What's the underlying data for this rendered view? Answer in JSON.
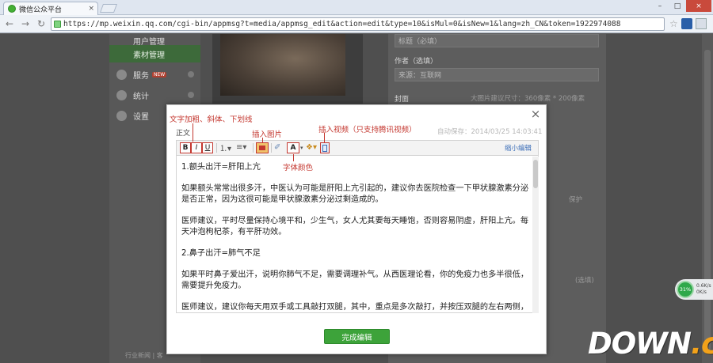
{
  "browser": {
    "tab_title": "微信公众平台",
    "tab_close": "×",
    "url": "https://mp.weixin.qq.com/cgi-bin/appmsg?t=media/appmsg_edit&action=edit&type=10&isMul=0&isNew=1&lang=zh_CN&token=1922974088",
    "window_buttons": [
      "–",
      "□",
      "×"
    ]
  },
  "sidebar": {
    "items": [
      {
        "label": "用户管理"
      },
      {
        "label": "素材管理"
      },
      {
        "label": "服务",
        "badge": "NEW"
      },
      {
        "label": "统计"
      },
      {
        "label": "设置"
      }
    ],
    "footer": "行业新闻 | 客"
  },
  "background_form": {
    "title_placeholder": "标题（必填）",
    "author_label": "作者（选填）",
    "author_value": "来源：互联网",
    "cover_label": "封面",
    "cover_hint": "大图片建议尺寸：360像素 * 200像素",
    "right_snip": "保护",
    "right_snip2": "(选填)"
  },
  "modal": {
    "close": "×",
    "section_label": "正文",
    "autosave": "自动保存：2014/03/25 14:03:41",
    "toolbar": {
      "bold": "B",
      "italic": "I",
      "underline": "U",
      "ordered_list": "⒈▾",
      "unordered_list": "≡▾",
      "font_color": "A",
      "shrink_link": "缩小编辑"
    },
    "content": [
      "1.额头出汗=肝阳上亢",
      "如果额头常常出很多汗，中医认为可能是肝阳上亢引起的，建议你去医院检查一下甲状腺激素分泌是否正常，因为这很可能是甲状腺激素分泌过剩造成的。",
      "医师建议，平时尽量保持心境平和，少生气，女人尤其要每天睡饱，否则容易阴虚，肝阳上亢。每天冲泡枸杞茶，有平肝功效。",
      "2.鼻子出汗=肺气不足",
      "如果平时鼻子爱出汗，说明你肺气不足，需要调理补气。从西医理论看，你的免疫力也多半很低，需要提升免疫力。",
      "医师建议，建议你每天用双手或工具敲打双腿，其中，重点是多次敲打，并按压双腿的左右两侧，因为这是你身体上瞬间效益的部位，通过这样活动的刺激法，刺激相应穴位的作用"
    ],
    "done_button": "完成编辑"
  },
  "annotations": {
    "text_format": "文字加粗、斜体、下划线",
    "insert_image": "插入图片",
    "insert_video": "插入视频（只支持腾讯视频）",
    "font_color": "字体颜色"
  },
  "speed_widget": {
    "percent": "31%",
    "line1": "0.6K/s",
    "line2": "0K/s"
  },
  "watermark": {
    "brand": "DOWN",
    "suffix": ".cc"
  },
  "colors": {
    "accent_green": "#3da33a",
    "annotation_red": "#c4372f",
    "link_blue": "#3d6fb8"
  }
}
